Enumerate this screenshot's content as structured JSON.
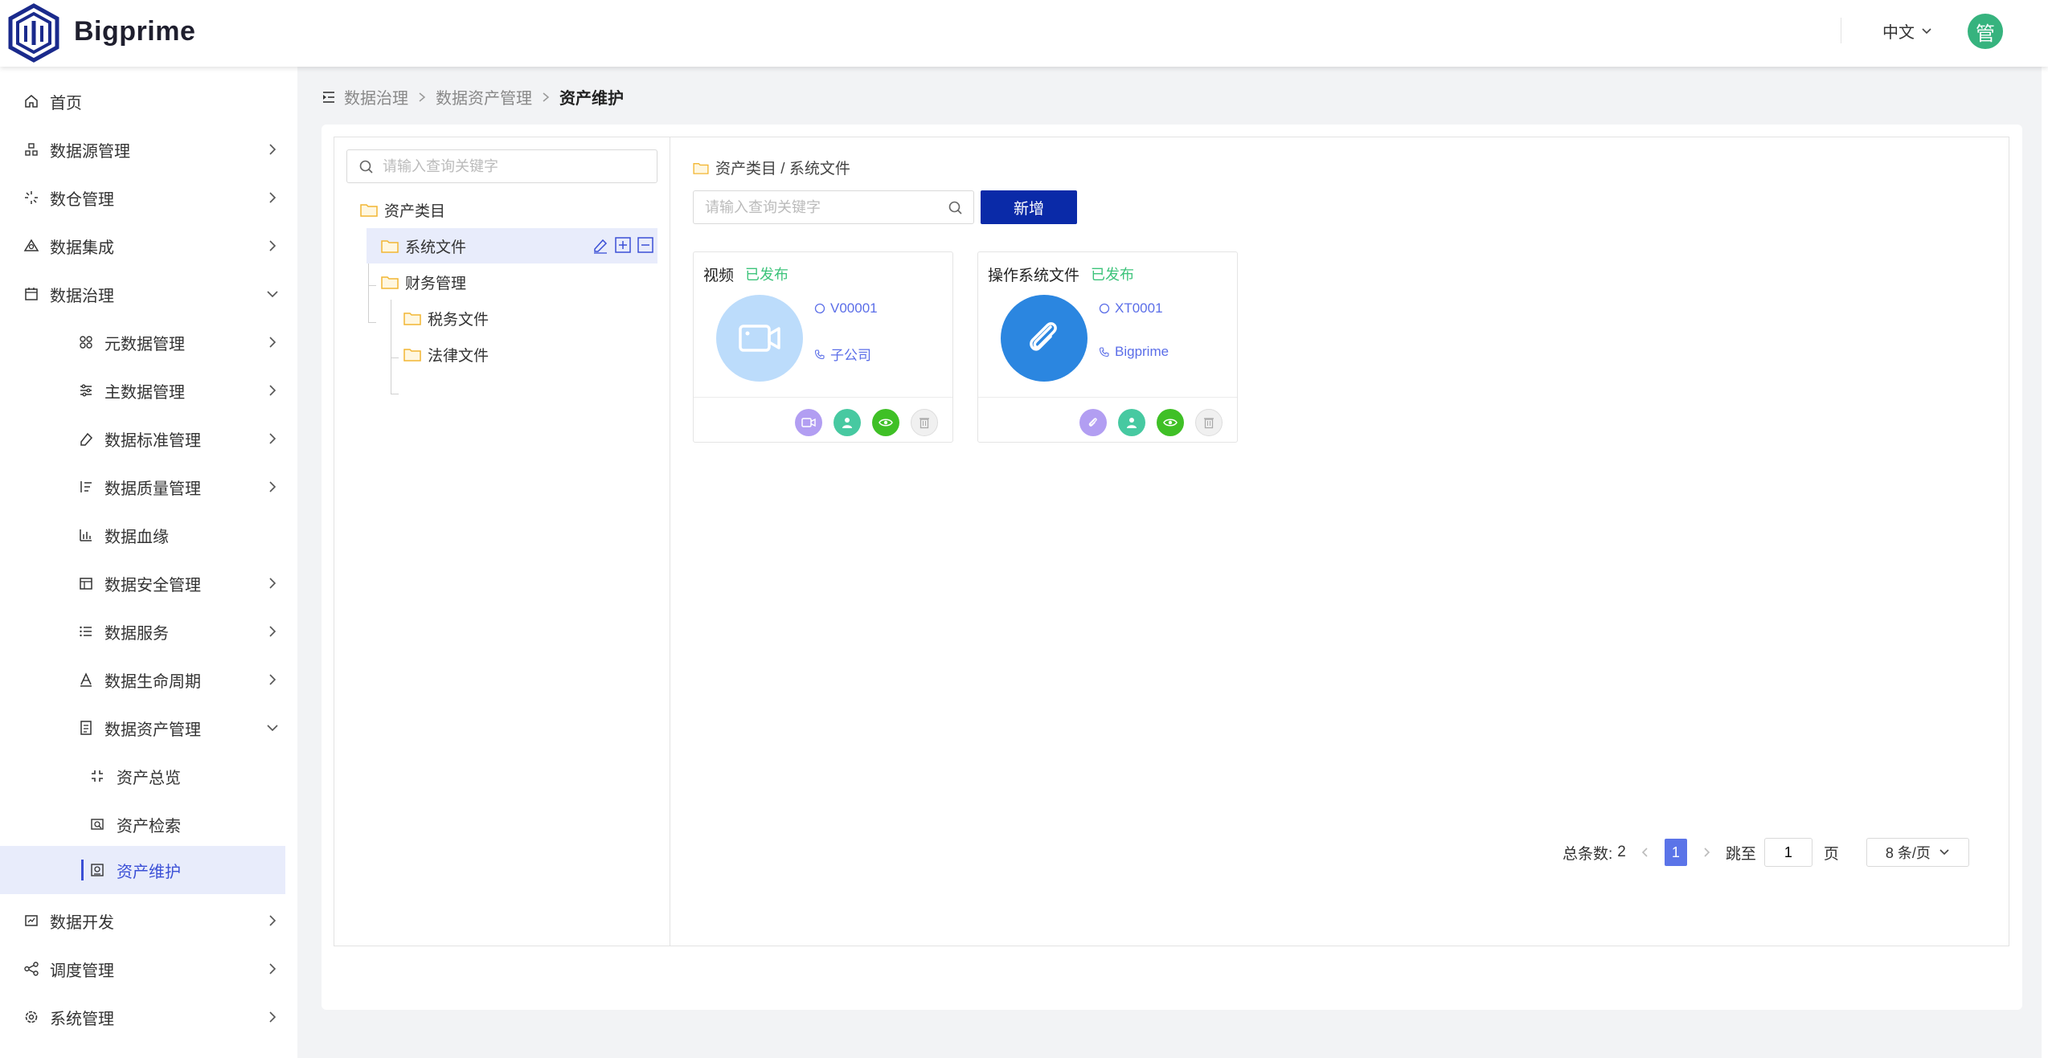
{
  "header": {
    "brand": "Bigprime",
    "language": "中文",
    "avatar_text": "管"
  },
  "sidebar": {
    "items": [
      {
        "label": "首页",
        "icon": "home-icon"
      },
      {
        "label": "数据源管理",
        "icon": "datasource-icon"
      },
      {
        "label": "数仓管理",
        "icon": "warehouse-icon"
      },
      {
        "label": "数据集成",
        "icon": "integration-icon"
      },
      {
        "label": "数据治理",
        "icon": "governance-icon"
      },
      {
        "label": "元数据管理",
        "icon": "metadata-icon"
      },
      {
        "label": "主数据管理",
        "icon": "masterdata-icon"
      },
      {
        "label": "数据标准管理",
        "icon": "standard-icon"
      },
      {
        "label": "数据质量管理",
        "icon": "quality-icon"
      },
      {
        "label": "数据血缘",
        "icon": "lineage-icon"
      },
      {
        "label": "数据安全管理",
        "icon": "security-icon"
      },
      {
        "label": "数据服务",
        "icon": "service-icon"
      },
      {
        "label": "数据生命周期",
        "icon": "lifecycle-icon"
      },
      {
        "label": "数据资产管理",
        "icon": "asset-icon"
      },
      {
        "label": "资产总览",
        "icon": "overview-icon"
      },
      {
        "label": "资产检索",
        "icon": "retrieval-icon"
      },
      {
        "label": "资产维护",
        "icon": "maintenance-icon"
      },
      {
        "label": "数据开发",
        "icon": "develop-icon"
      },
      {
        "label": "调度管理",
        "icon": "schedule-icon"
      },
      {
        "label": "系统管理",
        "icon": "system-icon"
      }
    ]
  },
  "breadcrumb": {
    "items": [
      "数据治理",
      "数据资产管理"
    ],
    "current": "资产维护"
  },
  "tree": {
    "search_placeholder": "请输入查询关键字",
    "nodes": [
      "资产类目",
      "系统文件",
      "财务管理",
      "税务文件",
      "法律文件"
    ]
  },
  "content": {
    "path": "资产类目 / 系统文件",
    "search_placeholder": "请输入查询关键字",
    "add_label": "新增",
    "cards": [
      {
        "title": "视频",
        "status": "已发布",
        "code": "V00001",
        "owner": "子公司",
        "icon": "video-camera-icon"
      },
      {
        "title": "操作系统文件",
        "status": "已发布",
        "code": "XT0001",
        "owner": "Bigprime",
        "icon": "paperclip-icon"
      }
    ]
  },
  "pagination": {
    "total_label": "总条数:",
    "total": "2",
    "current_page": "1",
    "jump_label": "跳至",
    "jump_value": "1",
    "page_suffix": "页",
    "page_size": "8 条/页"
  },
  "colors": {
    "primary": "#0a2aa8",
    "accent": "#5b74e8",
    "published": "#3cc37a",
    "avatar": "#36b37e"
  }
}
